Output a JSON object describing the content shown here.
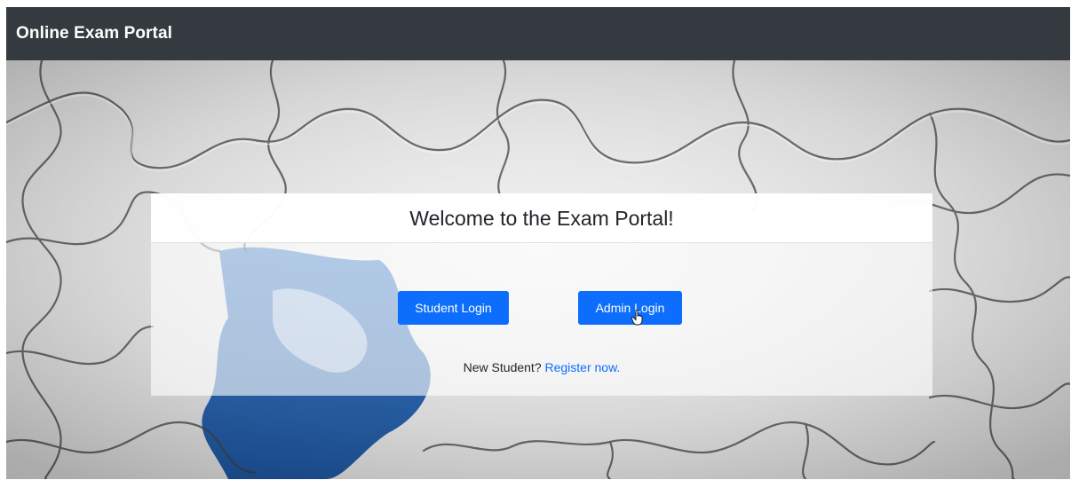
{
  "navbar": {
    "brand": "Online Exam Portal"
  },
  "card": {
    "title": "Welcome to the Exam Portal!",
    "student_login_label": "Student Login",
    "admin_login_label": "Admin Login",
    "register_prompt": "New Student?",
    "register_link": "Register now."
  },
  "colors": {
    "navbar_bg": "#343a40",
    "primary_button": "#0d6efd",
    "link": "#0d6efd",
    "puzzle_blue": "#1f5fae"
  },
  "icons": {
    "cursor": "hand-pointer-icon"
  }
}
